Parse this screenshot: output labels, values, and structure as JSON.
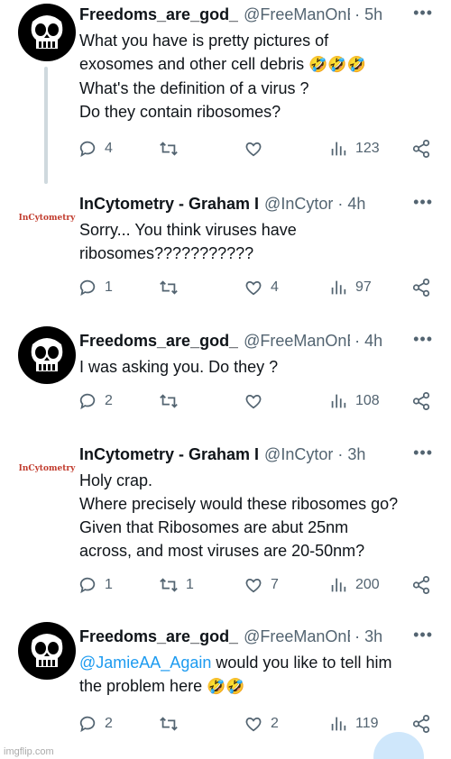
{
  "tweets": [
    {
      "name": "Freedoms_are_god_",
      "handle": "@FreeManOnE",
      "time": "5h",
      "avatar": "punisher-skull",
      "lines": [
        "What you have is pretty pictures of",
        "exosomes and other cell debris",
        "What's the definition of a virus ?",
        "Do they contain ribosomes?"
      ],
      "emoji_after_line_2": "🤣🤣🤣",
      "replies": "4",
      "retweets": "",
      "likes": "",
      "views": "123"
    },
    {
      "name": "InCytometry - Graham I",
      "handle": "@InCytor",
      "time": "4h",
      "avatar": "incytometry-logo",
      "lines": [
        "Sorry... You think viruses have",
        "ribosomes???????????"
      ],
      "replies": "1",
      "retweets": "",
      "likes": "4",
      "views": "97"
    },
    {
      "name": "Freedoms_are_god_",
      "handle": "@FreeManOnE",
      "time": "4h",
      "avatar": "punisher-skull",
      "lines": [
        "I was asking you. Do they ?"
      ],
      "replies": "2",
      "retweets": "",
      "likes": "",
      "views": "108"
    },
    {
      "name": "InCytometry - Graham I",
      "handle": "@InCytor",
      "time": "3h",
      "avatar": "incytometry-logo",
      "lines": [
        "Holy crap.",
        "Where precisely would these ribosomes go?",
        "Given that Ribosomes are abut 25nm",
        "across, and most viruses are 20-50nm?"
      ],
      "replies": "1",
      "retweets": "1",
      "likes": "7",
      "views": "200"
    },
    {
      "name": "Freedoms_are_god_",
      "handle": "@FreeManOnE",
      "time": "3h",
      "avatar": "punisher-skull",
      "mention": "@JamieAA_Again",
      "lines": [
        " would you like to tell him",
        "the problem here"
      ],
      "emoji_after_last": "🤣🤣",
      "replies": "2",
      "retweets": "",
      "likes": "2",
      "views": "119"
    }
  ],
  "logo_text": "InCytometry",
  "separator": "·",
  "more_glyph": "•••",
  "watermark": "imgflip.com",
  "colors": {
    "text": "#0f1419",
    "muted": "#536471",
    "link": "#1d9bf0",
    "thread": "#cfd9de"
  }
}
